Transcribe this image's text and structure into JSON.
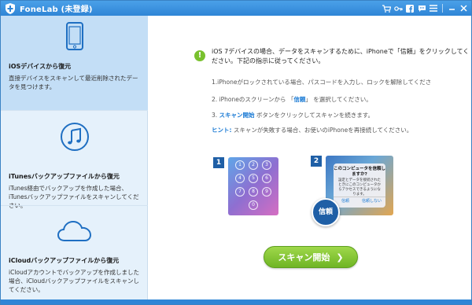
{
  "app": {
    "title": "FoneLab (未登録)"
  },
  "titlebar_icons": [
    "cart-icon",
    "key-icon",
    "facebook-icon",
    "chat-icon",
    "menu-icon",
    "minimize-icon",
    "close-icon"
  ],
  "sidebar": {
    "items": [
      {
        "label": "iOSデバイスから復元",
        "desc": "直接デバイスをスキャンして最近削除されたデータを見つけます。",
        "icon": "phone-icon",
        "active": true
      },
      {
        "label": "iTunesバックアップファイルから復元",
        "desc": "iTunes経由でバックアップを作成した場合、iTunesバックアップファイルをスキャンしてください。",
        "icon": "music-note-icon",
        "active": false
      },
      {
        "label": "iCloudバックアップファイルから復元",
        "desc": "iCloudアカウントでバックアップを作成しました場合、iCloudバックアップファイルをスキャンしてください。",
        "icon": "cloud-icon",
        "active": false
      }
    ]
  },
  "main": {
    "notice": "iOS 7デバイスの場合、データをスキャンするために、iPhoneで「信頼」をクリックしてください。下記の指示に従ってください。",
    "steps": [
      {
        "pre": "1.iPhoneがロックされている場合、パスコードを入力し、ロックを解除してくださ",
        "hl": "",
        "post": ""
      },
      {
        "pre": "2. iPhoneのスクリーンから 「",
        "hl": "信頼",
        "post": "」 を選択してください。"
      },
      {
        "pre": "3.  ",
        "hl": "スキャン開始",
        "post": " ボタンをクリックしてスキャンを続きます。"
      }
    ],
    "hint_label": "ヒント:",
    "hint_text": " スキャンが失敗する場合、お使いのiPhoneを再接続してください。",
    "step1_num": "1",
    "step2_num": "2",
    "keypad": [
      "1",
      "2",
      "3",
      "4",
      "5",
      "6",
      "7",
      "8",
      "9",
      "0"
    ],
    "dialog": {
      "title": "このコンピュータを信頼しますか?",
      "body": "設定とデータを接続されたときにこのコンピュータからアクセスできるようになります。",
      "trust": "信頼",
      "dont_trust": "信頼しない"
    },
    "trust_bubble": "信頼",
    "scan_button": "スキャン開始",
    "scan_arrow": "❯"
  },
  "colors": {
    "titlebar": "#2f85d6",
    "sidebar": "#e5f1fb",
    "sidebar_active": "#c3def6",
    "accent": "#1a7ad4",
    "button": "#7cc22b"
  }
}
